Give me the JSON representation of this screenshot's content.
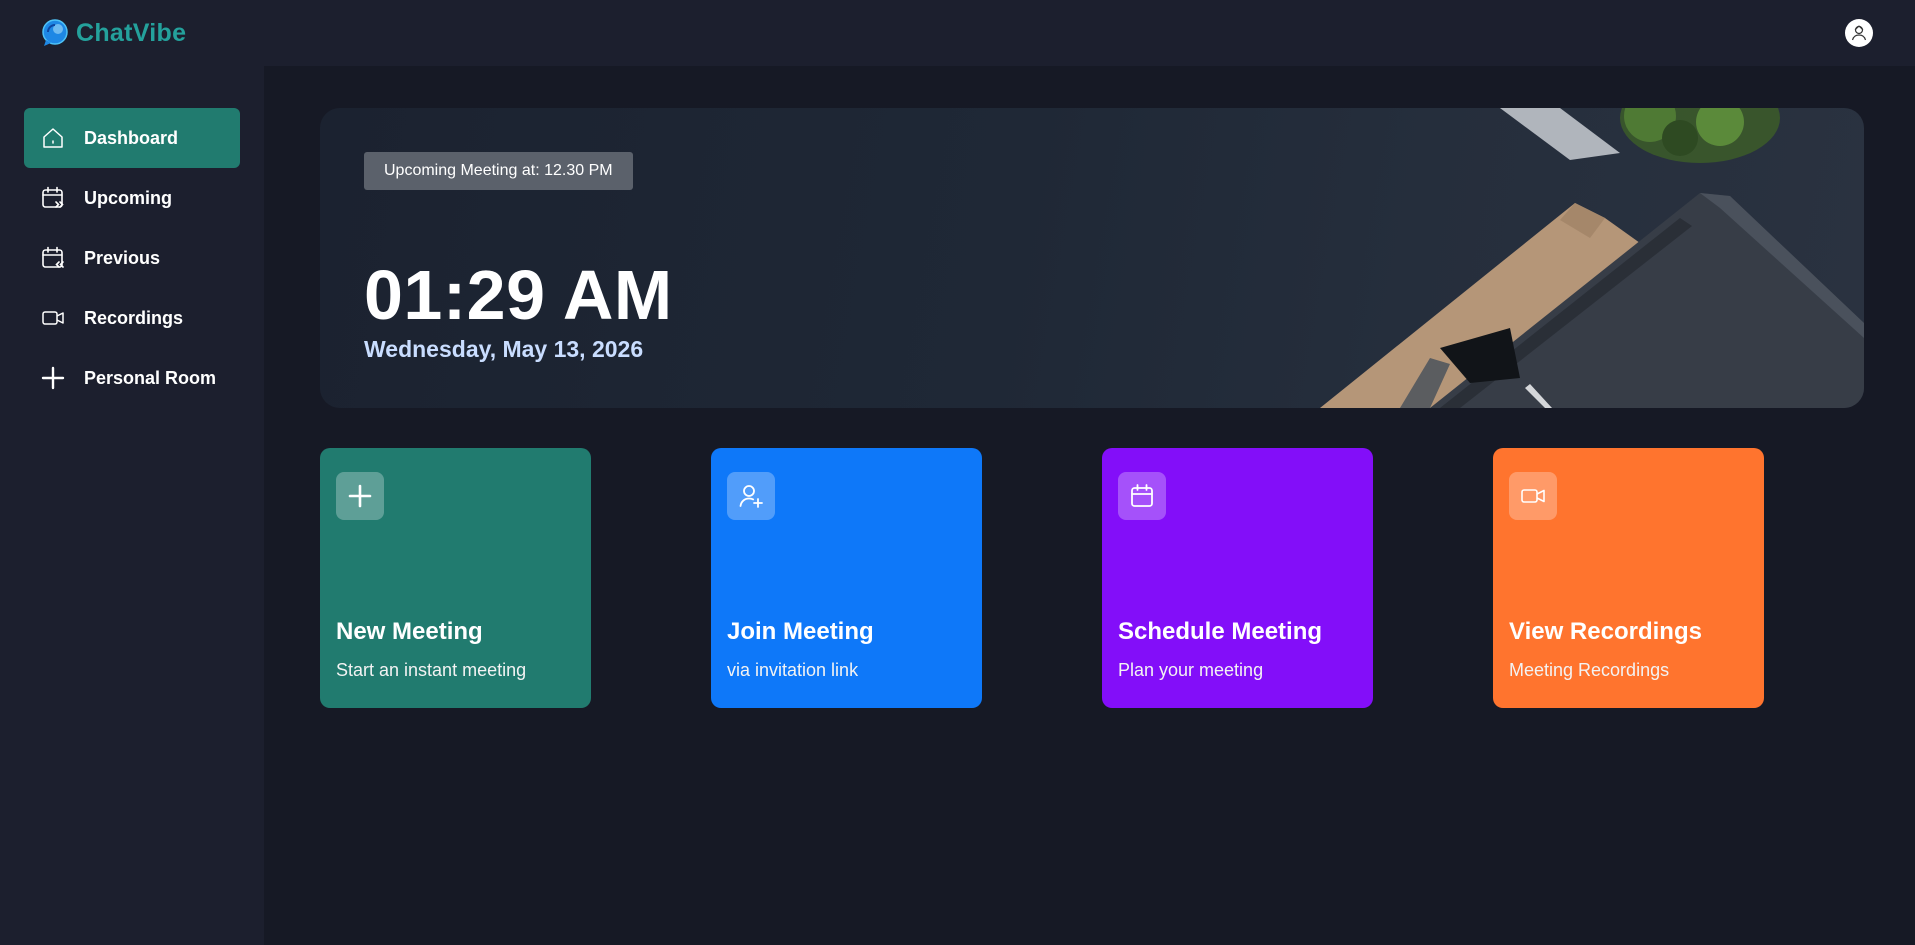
{
  "app": {
    "brand_name": "ChatVibe"
  },
  "header": {
    "avatar_icon": "user-avatar-icon"
  },
  "sidebar": {
    "items": [
      {
        "label": "Dashboard",
        "icon": "home-icon",
        "active": true
      },
      {
        "label": "Upcoming",
        "icon": "calendar-forward-icon",
        "active": false
      },
      {
        "label": "Previous",
        "icon": "calendar-back-icon",
        "active": false
      },
      {
        "label": "Recordings",
        "icon": "video-icon",
        "active": false
      },
      {
        "label": "Personal Room",
        "icon": "plus-icon",
        "active": false
      }
    ]
  },
  "hero": {
    "upcoming_badge": "Upcoming Meeting at: 12.30 PM",
    "time": "01:29 AM",
    "date": "Wednesday, May 13, 2026"
  },
  "cards": [
    {
      "title": "New Meeting",
      "subtitle": "Start an instant meeting",
      "icon": "plus-icon",
      "color": "#217b6f"
    },
    {
      "title": "Join Meeting",
      "subtitle": "via invitation link",
      "icon": "user-add-icon",
      "color": "#0e78f9"
    },
    {
      "title": "Schedule Meeting",
      "subtitle": "Plan your meeting",
      "icon": "calendar-icon",
      "color": "#830ef9"
    },
    {
      "title": "View Recordings",
      "subtitle": "Meeting Recordings",
      "icon": "video-icon",
      "color": "#ff742e"
    }
  ],
  "colors": {
    "background": "#161925",
    "panel": "#1c1f2e",
    "brand": "#24a19c",
    "active_nav": "#217b6f",
    "date_text": "#c9ddff"
  }
}
